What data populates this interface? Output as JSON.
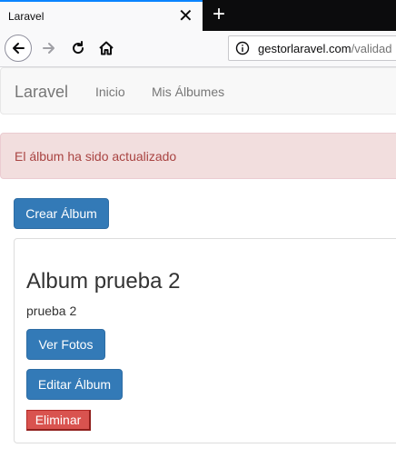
{
  "browser": {
    "tab_title": "Laravel",
    "close_glyph": "✕",
    "newtab_glyph": "+",
    "url_host": "gestorlaravel.com",
    "url_path": "/validad"
  },
  "navbar": {
    "brand": "Laravel",
    "links": [
      {
        "label": "Inicio"
      },
      {
        "label": "Mis Álbumes"
      }
    ]
  },
  "alert": {
    "message": "El álbum ha sido actualizado"
  },
  "actions": {
    "create_album": "Crear Álbum"
  },
  "album": {
    "title": "Album prueba 2",
    "description": "prueba 2",
    "view_photos": "Ver Fotos",
    "edit_album": "Editar Álbum",
    "delete": "Eliminar"
  },
  "colors": {
    "primary": "#337ab7",
    "danger": "#d9534f",
    "alert_bg": "#f2dede",
    "alert_text": "#a94442",
    "tab_accent": "#0a84ff"
  },
  "icons": [
    "back-arrow-icon",
    "forward-arrow-icon",
    "reload-icon",
    "home-icon",
    "info-icon",
    "close-icon",
    "new-tab-icon"
  ]
}
